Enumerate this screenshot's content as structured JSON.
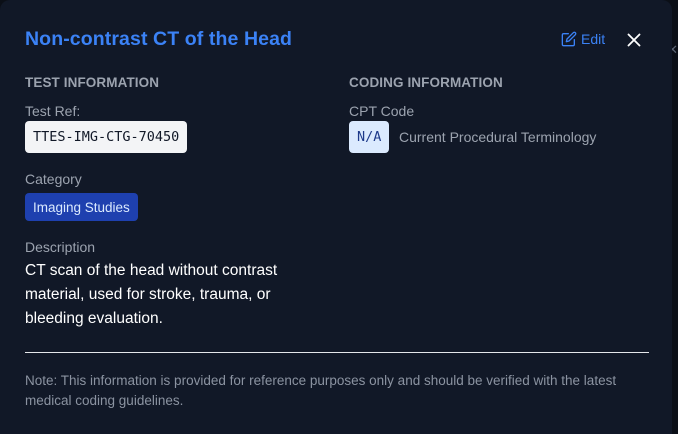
{
  "modal": {
    "title": "Non-contrast CT of the Head",
    "edit_label": "Edit"
  },
  "test_information": {
    "heading": "TEST INFORMATION",
    "test_ref_label": "Test Ref:",
    "test_ref_value": "TTES-IMG-CTG-70450",
    "category_label": "Category",
    "category_value": "Imaging Studies",
    "description_label": "Description",
    "description_value": "CT scan of the head without contrast material, used for stroke, trauma, or bleeding evaluation."
  },
  "coding_information": {
    "heading": "CODING INFORMATION",
    "cpt_label": "CPT Code",
    "cpt_value": "N/A",
    "cpt_meaning": "Current Procedural Terminology"
  },
  "footer": {
    "note": "Note: This information is provided for reference purposes only and should be verified with the latest medical coding guidelines."
  },
  "icons": {
    "edit": "edit-icon",
    "close": "close-icon",
    "side_close": "close-icon"
  },
  "colors": {
    "accent": "#3b82f6",
    "badge_bg": "#1e40af",
    "cpt_chip_bg": "#dbeafe",
    "modal_bg": "#111827"
  }
}
